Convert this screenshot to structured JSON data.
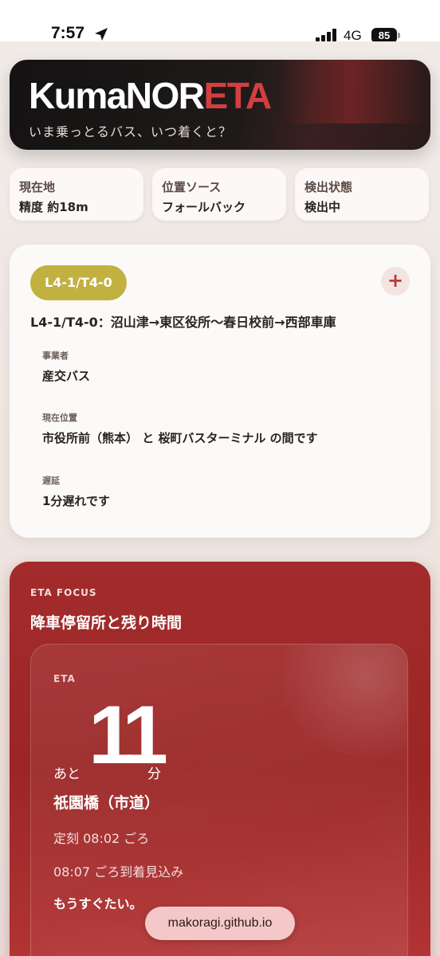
{
  "status_bar": {
    "time": "7:57",
    "network": "4G",
    "battery": "85"
  },
  "hero": {
    "title_main": "KumaNOR",
    "title_accent": "ETA",
    "subtitle": "いま乗っとるバス、いつ着くと？"
  },
  "info_cards": [
    {
      "label": "現在地",
      "value": "精度 約18m"
    },
    {
      "label": "位置ソース",
      "value": "フォールバック"
    },
    {
      "label": "検出状態",
      "value": "検出中"
    }
  ],
  "route": {
    "badge": "L4-1/T4-0",
    "add_label": "+",
    "name": "L4-1/T4-0：沼山津→東区役所〜春日校前→西部車庫",
    "fields": [
      {
        "label": "事業者",
        "value": "産交バス"
      },
      {
        "label": "現在位置",
        "value": "市役所前（熊本） と 桜町バスターミナル の間です"
      },
      {
        "label": "遅延",
        "value": "1分遅れです"
      }
    ]
  },
  "eta": {
    "kicker": "ETA FOCUS",
    "heading": "降車停留所と残り時間",
    "tag": "ETA",
    "prefix": "あと",
    "minutes": "11",
    "suffix": "分",
    "stop": "祇園橋（市道）",
    "scheduled": "定刻 08:02 ごろ",
    "expected": "08:07 ごろ到着見込み",
    "note": "もうすぐたい。"
  },
  "browser": {
    "url": "makoragi.github.io"
  },
  "colors": {
    "accent": "#d53e3e",
    "badge": "#c2b041",
    "eta_bg": "#a32b2b"
  }
}
